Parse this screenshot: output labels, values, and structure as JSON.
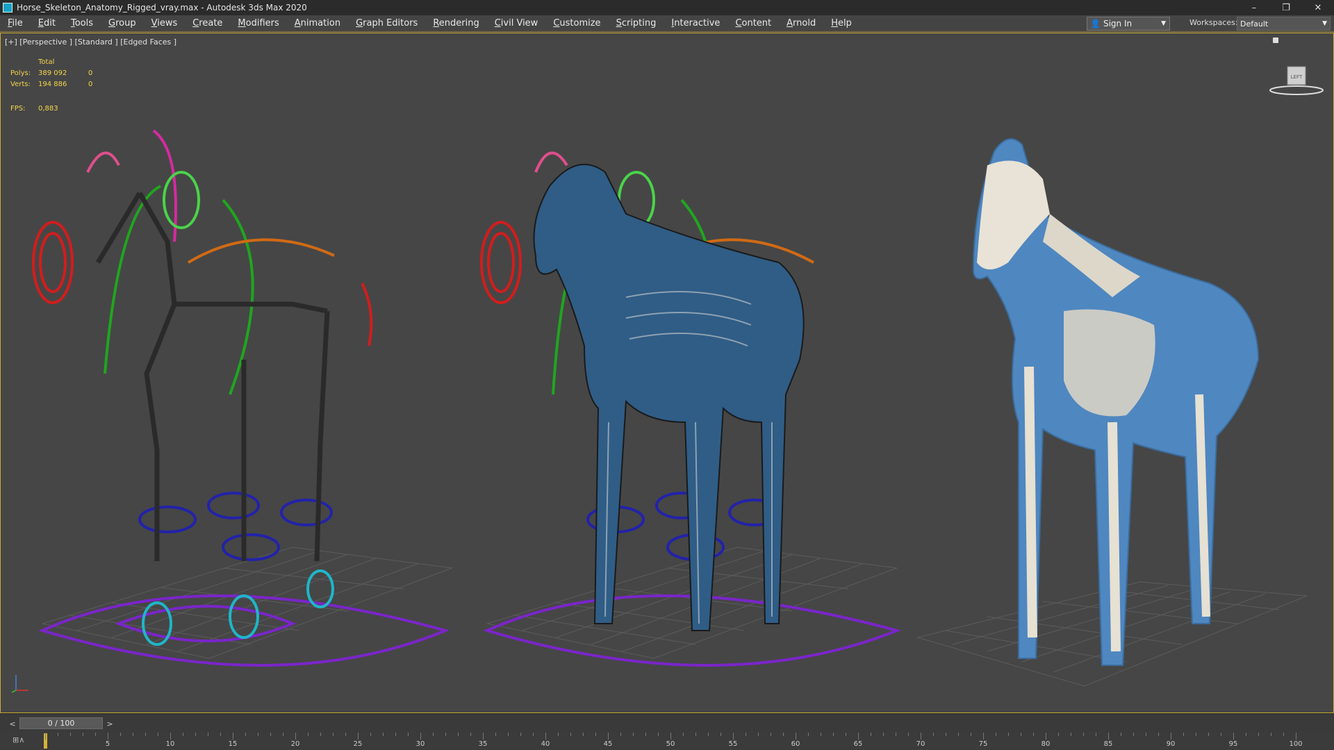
{
  "window": {
    "title": "Horse_Skeleton_Anatomy_Rigged_vray.max - Autodesk 3ds Max 2020",
    "controls": [
      "–",
      "❐",
      "✕"
    ]
  },
  "menu": [
    "File",
    "Edit",
    "Tools",
    "Group",
    "Views",
    "Create",
    "Modifiers",
    "Animation",
    "Graph Editors",
    "Rendering",
    "Civil View",
    "Customize",
    "Scripting",
    "Interactive",
    "Content",
    "Arnold",
    "Help"
  ],
  "signin": {
    "label": "Sign In"
  },
  "workspaces": {
    "label": "Workspaces:",
    "value": "Default"
  },
  "viewport": {
    "label": "[+] [Perspective ] [Standard ] [Edged Faces ]",
    "stats": {
      "header": "Total",
      "rows": [
        {
          "key": "Polys:",
          "value": "389 092",
          "sel": "0"
        },
        {
          "key": "Verts:",
          "value": "194 886",
          "sel": "0"
        }
      ],
      "fps_key": "FPS:",
      "fps_value": "0,883"
    },
    "viewcube_label": "LEFT"
  },
  "timeslider": {
    "value": "0 / 100",
    "prev": "<",
    "next": ">"
  },
  "trackbar": {
    "icon_label": "⊞∧",
    "labels": [
      "5",
      "10",
      "15",
      "20",
      "25",
      "30",
      "35",
      "40",
      "45",
      "50",
      "55",
      "60",
      "65",
      "70",
      "75",
      "80",
      "85",
      "90",
      "95",
      "100"
    ]
  },
  "colors": {
    "accent": "#cfae36",
    "stats_text": "#f4d54a",
    "viewport_bg": "#464646"
  }
}
